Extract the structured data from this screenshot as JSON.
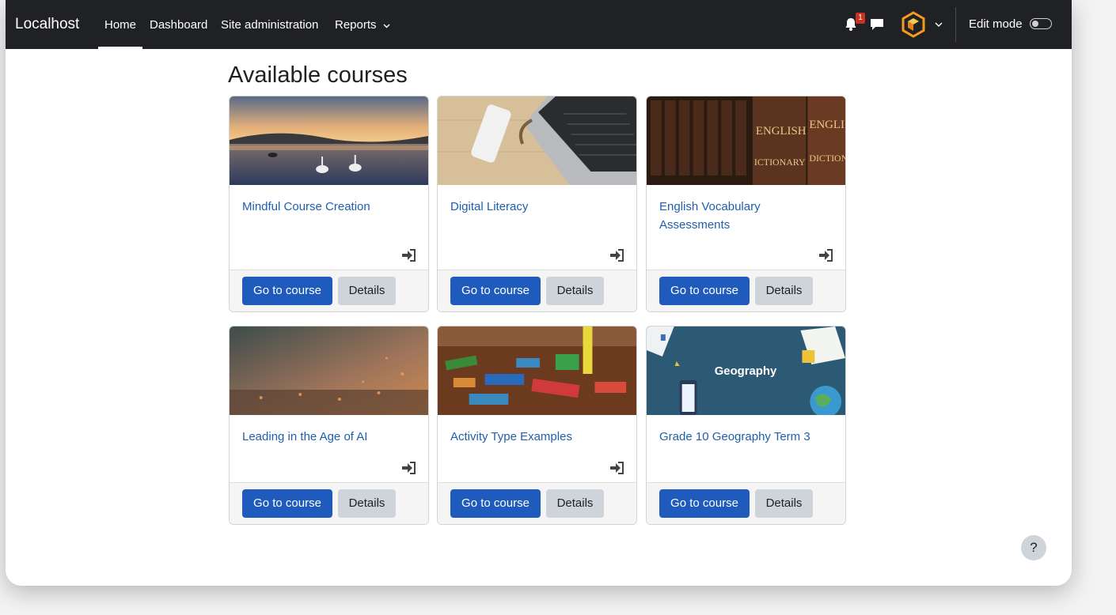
{
  "header": {
    "brand": "Localhost",
    "nav": [
      {
        "label": "Home"
      },
      {
        "label": "Dashboard"
      },
      {
        "label": "Site administration"
      },
      {
        "label": "Reports"
      }
    ],
    "notification_count": "1",
    "edit_mode_label": "Edit mode",
    "edit_mode_on": false
  },
  "page": {
    "title": "Available courses"
  },
  "courses": [
    {
      "title": "Mindful Course Creation",
      "go_label": "Go to course",
      "details_label": "Details",
      "enrol_icon": "sign-in-icon"
    },
    {
      "title": "Digital Literacy",
      "go_label": "Go to course",
      "details_label": "Details",
      "enrol_icon": "sign-in-icon"
    },
    {
      "title": "English Vocabulary Assessments",
      "go_label": "Go to course",
      "details_label": "Details",
      "enrol_icon": "sign-in-icon",
      "image_text": [
        "ENGLISH",
        "ICTIONARY",
        "ENGLIS",
        "DICTIONA"
      ]
    },
    {
      "title": "Leading in the Age of AI",
      "go_label": "Go to course",
      "details_label": "Details",
      "enrol_icon": "sign-in-icon"
    },
    {
      "title": "Activity Type Examples",
      "go_label": "Go to course",
      "details_label": "Details",
      "enrol_icon": "sign-in-icon"
    },
    {
      "title": "Grade 10 Geography Term 3",
      "go_label": "Go to course",
      "details_label": "Details",
      "image_text": [
        "Geography"
      ]
    }
  ],
  "help_label": "?",
  "colors": {
    "navbar": "#202124",
    "primary": "#1f5bbd",
    "link": "#1f5fad",
    "badge": "#ca3120"
  }
}
